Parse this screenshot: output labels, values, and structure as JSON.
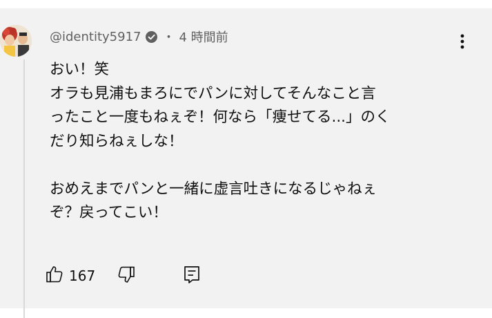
{
  "comment": {
    "author": "@identity5917",
    "verified": true,
    "separator": "・",
    "timestamp": "4 時間前",
    "lines": [
      "おい！笑",
      "オラも見浦もまろにでパンに対してそんなこと言",
      "ったこと一度もねぇぞ！何なら「痩せてる...」のく",
      "だり知らねぇしな！",
      "",
      "おめえまでパンと一緒に虚言吐きになるじゃねぇ",
      "ぞ？戻ってこい！"
    ],
    "like_count": "167"
  },
  "icons": {
    "verified": "check-circle-icon",
    "menu": "more-vertical-icon",
    "like": "thumbs-up-icon",
    "dislike": "thumbs-down-icon",
    "reply": "reply-icon"
  },
  "colors": {
    "background": "#f2f2f2",
    "secondary_text": "#606060",
    "primary_text": "#0f0f0f"
  }
}
